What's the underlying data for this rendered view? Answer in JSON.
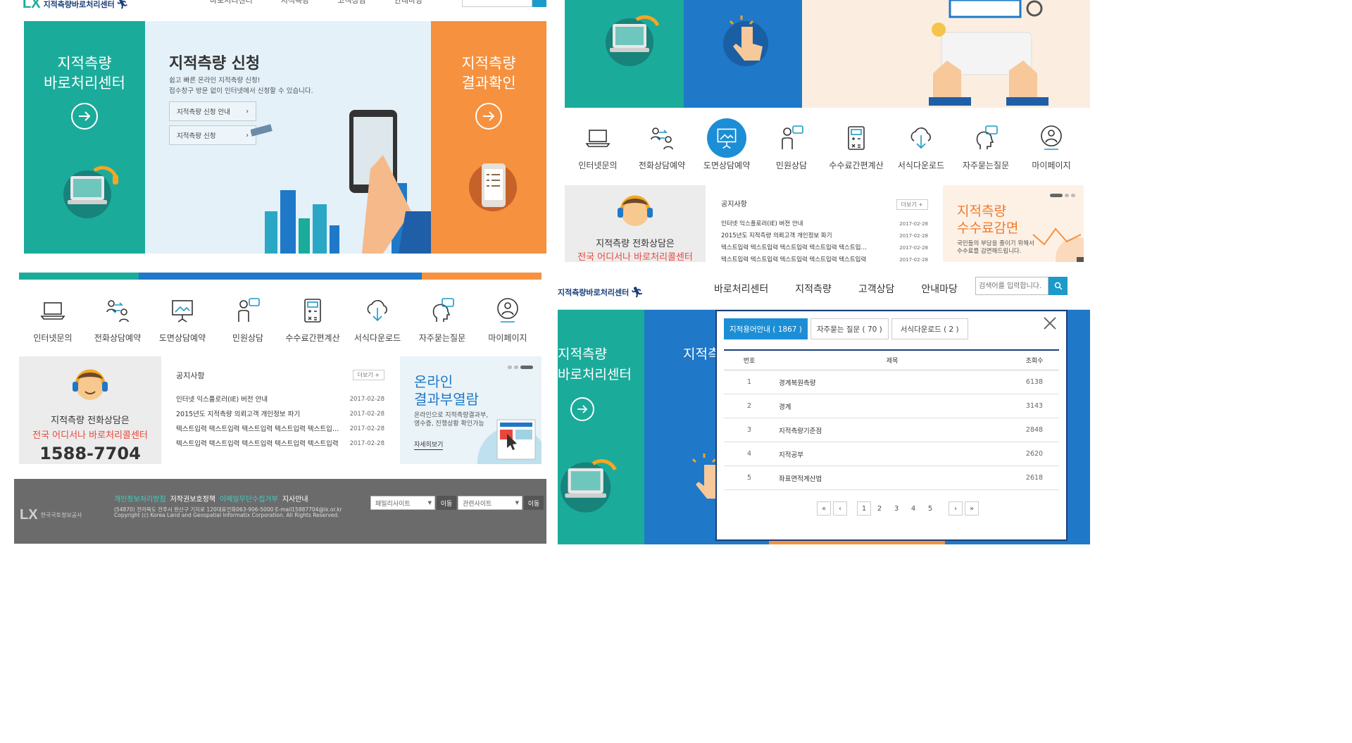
{
  "brand": {
    "logo_text": "지적측량바로처리센터"
  },
  "header": {
    "nav": [
      "바로처리센터",
      "지적측량",
      "고객상담",
      "안내마당"
    ],
    "search_placeholder": "검색어를 입력합니다."
  },
  "hero": {
    "left_tile": {
      "line1": "지적측량",
      "line2": "바로처리센터"
    },
    "center": {
      "title": "지적측량 신청",
      "desc1": "쉽고 빠른 온라인 지적측량 신청!",
      "desc2": "접수창구 방문 없이 인터넷에서 신청할 수 있습니다.",
      "btn1": "지적측량 신청 안내",
      "btn2": "지적측량 신청"
    },
    "right_tile": {
      "line1": "지적측량",
      "line2": "결과확인"
    }
  },
  "quick_menu": [
    {
      "label": "인터넷문의",
      "icon": "laptop-icon"
    },
    {
      "label": "전화상담예약",
      "icon": "people-exchange-icon"
    },
    {
      "label": "도면상담예약",
      "icon": "presentation-board-icon"
    },
    {
      "label": "민원상담",
      "icon": "person-speech-icon"
    },
    {
      "label": "수수료간편계산",
      "icon": "calculator-icon"
    },
    {
      "label": "서식다운로드",
      "icon": "cloud-download-icon"
    },
    {
      "label": "자주묻는질문",
      "icon": "head-question-icon"
    },
    {
      "label": "마이페이지",
      "icon": "user-profile-icon"
    }
  ],
  "callcenter": {
    "line1": "지적측량 전화상담은",
    "line2": "전국 어디서나 바로처리콜센터",
    "phone": "1588-7704"
  },
  "notice": {
    "title": "공지사항",
    "more": "더보기 +",
    "items": [
      {
        "text": "인터넷 익스플로러(IE) 버전 안내",
        "date": "2017-02-28"
      },
      {
        "text": "2015년도 지적측량 의뢰고객 개인정보 파기",
        "date": "2017-02-28"
      },
      {
        "text": "텍스트입력 텍스트입력 텍스트입력 텍스트입력 텍스트입…",
        "date": "2017-02-28"
      },
      {
        "text": "텍스트입력 텍스트입력 텍스트입력 텍스트입력 텍스트입력",
        "date": "2017-02-28"
      }
    ]
  },
  "promo_online": {
    "line1": "온라인",
    "line2": "결과부열람",
    "desc1": "온라인으로 지적측량결과부,",
    "desc2": "영수증, 진행상황 확인가능",
    "link": "자세히보기"
  },
  "promo_fee": {
    "line1": "지적측량",
    "line2": "수수료감면",
    "desc1": "국민들의 부담을 줄이기 위해서",
    "desc2": "수수료를 감면해드립니다."
  },
  "footer": {
    "links": [
      "개인정보처리방침",
      "저작권보호정책",
      "이메일무단수집거부",
      "지사안내"
    ],
    "address": "(54870) 전라북도 전주시 완산구 기지로 120대표전화063-906-5000 E-mail15887704@lx.or.kr",
    "copyright": "Copyright (c) Korea Land and Geospatial Informatix Corporation. All Rights Reserved.",
    "org": "한국국토정보공사",
    "family_site": "패밀리사이트",
    "related_site": "관련사이트",
    "go": "이동"
  },
  "popup": {
    "tabs": [
      "지적용어안내 ( 1867 )",
      "자주묻는 질문 ( 70 )",
      "서식다운로드 ( 2 )"
    ],
    "columns": [
      "번호",
      "제목",
      "조회수"
    ],
    "rows": [
      {
        "no": "1",
        "title": "경계복원측량",
        "views": "6138"
      },
      {
        "no": "2",
        "title": "경계",
        "views": "3143"
      },
      {
        "no": "3",
        "title": "지적측량기준점",
        "views": "2848"
      },
      {
        "no": "4",
        "title": "지적공부",
        "views": "2620"
      },
      {
        "no": "5",
        "title": "좌표면적계산법",
        "views": "2618"
      }
    ],
    "pages": [
      "1",
      "2",
      "3",
      "4",
      "5"
    ]
  },
  "colors": {
    "teal": "#1bab9a",
    "blue": "#1f78c8",
    "orange": "#f5913f",
    "navy": "#1a3f7a",
    "footer": "#6b6b6b"
  }
}
